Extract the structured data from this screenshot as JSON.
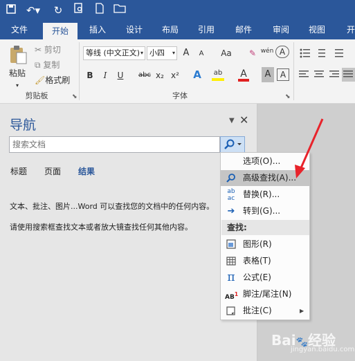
{
  "quick_access": {
    "save_icon": "save-icon",
    "undo_icon": "undo-icon",
    "redo_icon": "redo-icon",
    "print_preview_icon": "print-preview-icon",
    "new_icon": "new-doc-icon",
    "open_icon": "open-folder-icon"
  },
  "tabs": [
    "文件",
    "开始",
    "插入",
    "设计",
    "布局",
    "引用",
    "邮件",
    "审阅",
    "视图",
    "开"
  ],
  "ribbon": {
    "clipboard": {
      "paste": "粘贴",
      "cut": "剪切",
      "copy": "复制",
      "format_painter": "格式刷",
      "group": "剪贴板"
    },
    "font": {
      "font_name": "等线 (中文正文)",
      "font_size": "小四",
      "group": "字体",
      "bold": "B",
      "italic": "I",
      "underline": "U",
      "strike": "abc",
      "sub": "x₂",
      "sup": "x²",
      "grow": "A",
      "shrink": "A",
      "case": "Aa",
      "wen": "wén",
      "char_border": "A"
    }
  },
  "nav": {
    "title": "导航",
    "search_placeholder": "搜索文档",
    "tabs": [
      "标题",
      "页面",
      "结果"
    ],
    "text1": "文本、批注、图片...Word 可以查找您的文档中的任何内容。",
    "text2": "请使用搜索框查找文本或者放大镜查找任何其他内容。"
  },
  "menu": {
    "items": [
      "选项(O)...",
      "高级查找(A)...",
      "替换(R)...",
      "转到(G)..."
    ],
    "header": "查找:",
    "find_items": [
      "图形(R)",
      "表格(T)",
      "公式(E)",
      "脚注/尾注(N)",
      "批注(C)"
    ]
  },
  "watermark": {
    "brand": "Bai",
    "logo_text": "经验",
    "url": "jingyan.baidu.com"
  },
  "colors": {
    "accent": "#2b579a",
    "highlight": "#c5c5c5",
    "arrow": "#e8232b"
  }
}
